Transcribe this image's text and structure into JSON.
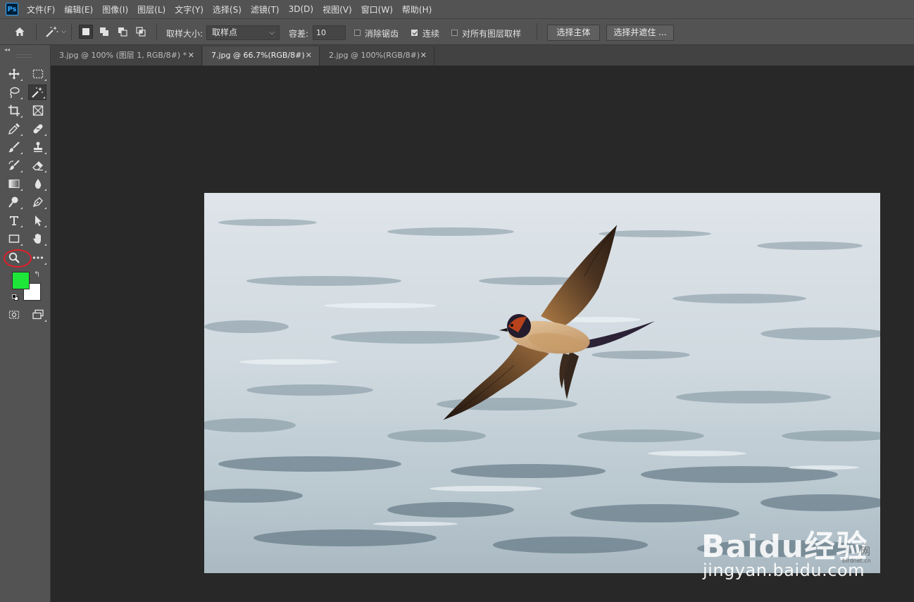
{
  "app": {
    "logo_text": "Ps"
  },
  "menu": [
    "文件(F)",
    "编辑(E)",
    "图像(I)",
    "图层(L)",
    "文字(Y)",
    "选择(S)",
    "滤镜(T)",
    "3D(D)",
    "视图(V)",
    "窗口(W)",
    "帮助(H)"
  ],
  "options": {
    "sample_size_label": "取样大小:",
    "sample_size_value": "取样点",
    "tolerance_label": "容差:",
    "tolerance_value": "10",
    "antialias_label": "消除锯齿",
    "antialias_checked": false,
    "contiguous_label": "连续",
    "contiguous_checked": true,
    "sample_all_layers_label": "对所有图层取样",
    "sample_all_layers_checked": false,
    "select_subject_label": "选择主体",
    "select_and_mask_label": "选择并遮住 ..."
  },
  "tabs": [
    {
      "label": "3.jpg @ 100% (图层 1, RGB/8#) *",
      "active": false
    },
    {
      "label": "7.jpg @ 66.7%(RGB/8#)",
      "active": true
    },
    {
      "label": "2.jpg @ 100%(RGB/8#)",
      "active": false
    }
  ],
  "colors": {
    "foreground": "#1ee639",
    "background": "#ffffff",
    "highlight": "#e0202a"
  },
  "watermark": {
    "brand_prefix": "Bai",
    "brand_du": "du",
    "brand_suffix": "经验",
    "url": "jingyan.baidu.com",
    "tag_small": "birdnet.cn",
    "tag_net": "网"
  }
}
